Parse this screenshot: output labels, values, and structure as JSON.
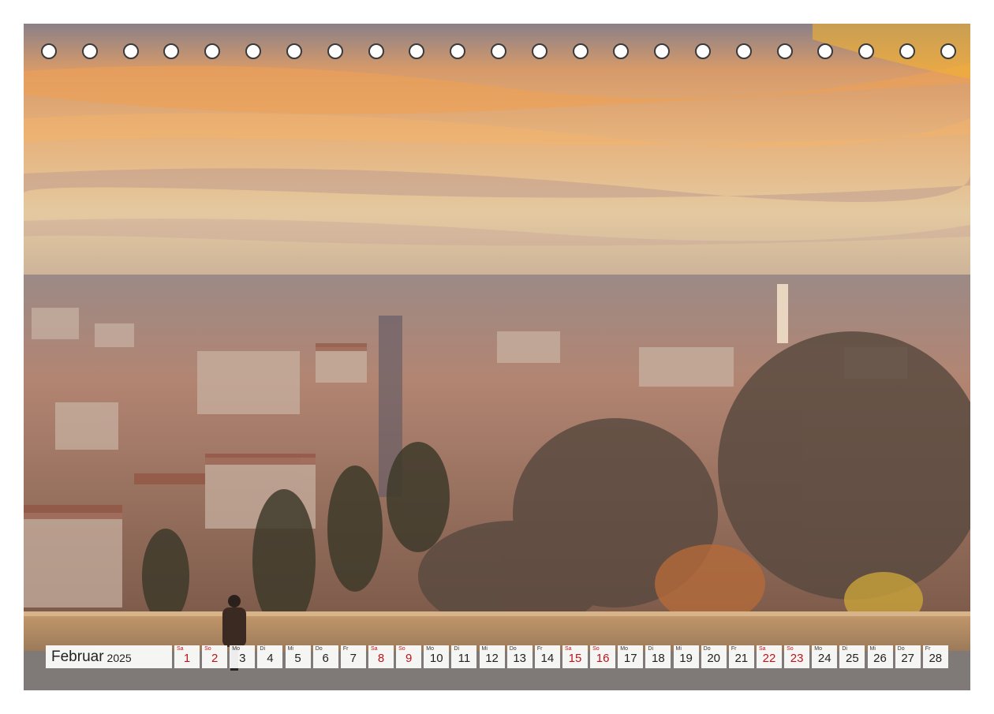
{
  "calendar": {
    "month": "Februar",
    "year": "2025",
    "days": [
      {
        "wd": "Sa",
        "num": "1",
        "weekend": true
      },
      {
        "wd": "So",
        "num": "2",
        "weekend": true
      },
      {
        "wd": "Mo",
        "num": "3",
        "weekend": false
      },
      {
        "wd": "Di",
        "num": "4",
        "weekend": false
      },
      {
        "wd": "Mi",
        "num": "5",
        "weekend": false
      },
      {
        "wd": "Do",
        "num": "6",
        "weekend": false
      },
      {
        "wd": "Fr",
        "num": "7",
        "weekend": false
      },
      {
        "wd": "Sa",
        "num": "8",
        "weekend": true
      },
      {
        "wd": "So",
        "num": "9",
        "weekend": true
      },
      {
        "wd": "Mo",
        "num": "10",
        "weekend": false
      },
      {
        "wd": "Di",
        "num": "11",
        "weekend": false
      },
      {
        "wd": "Mi",
        "num": "12",
        "weekend": false
      },
      {
        "wd": "Do",
        "num": "13",
        "weekend": false
      },
      {
        "wd": "Fr",
        "num": "14",
        "weekend": false
      },
      {
        "wd": "Sa",
        "num": "15",
        "weekend": true
      },
      {
        "wd": "So",
        "num": "16",
        "weekend": true
      },
      {
        "wd": "Mo",
        "num": "17",
        "weekend": false
      },
      {
        "wd": "Di",
        "num": "18",
        "weekend": false
      },
      {
        "wd": "Mi",
        "num": "19",
        "weekend": false
      },
      {
        "wd": "Do",
        "num": "20",
        "weekend": false
      },
      {
        "wd": "Fr",
        "num": "21",
        "weekend": false
      },
      {
        "wd": "Sa",
        "num": "22",
        "weekend": true
      },
      {
        "wd": "So",
        "num": "23",
        "weekend": true
      },
      {
        "wd": "Mo",
        "num": "24",
        "weekend": false
      },
      {
        "wd": "Di",
        "num": "25",
        "weekend": false
      },
      {
        "wd": "Mi",
        "num": "26",
        "weekend": false
      },
      {
        "wd": "Do",
        "num": "27",
        "weekend": false
      },
      {
        "wd": "Fr",
        "num": "28",
        "weekend": false
      }
    ]
  },
  "binding_holes": 23,
  "colors": {
    "weekend": "#c0141c",
    "sky_top": "#8a7f86",
    "sky_glow": "#f2a659",
    "horizon": "#d9b98c",
    "city": "#a07a66"
  }
}
